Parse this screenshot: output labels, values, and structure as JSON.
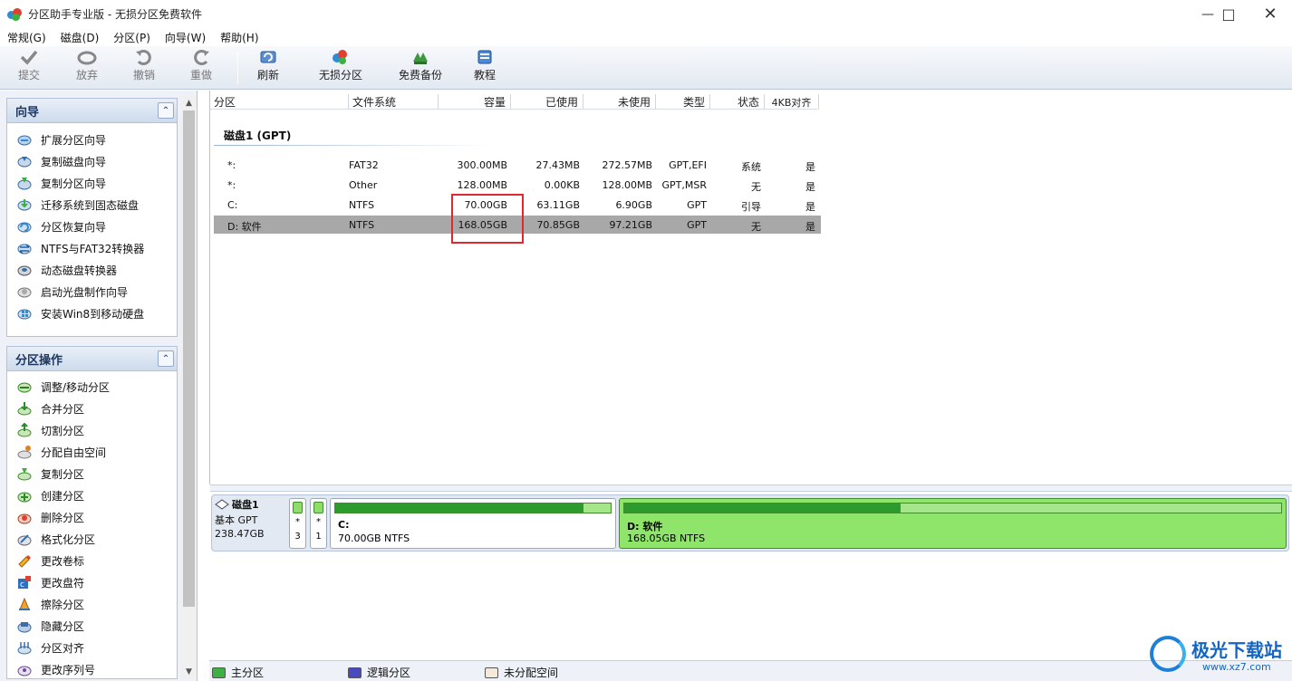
{
  "window": {
    "title": "分区助手专业版 - 无损分区免费软件"
  },
  "menu": [
    "常规(G)",
    "磁盘(D)",
    "分区(P)",
    "向导(W)",
    "帮助(H)"
  ],
  "toolbar": {
    "submit": "提交",
    "discard": "放弃",
    "undo": "撤销",
    "redo": "重做",
    "refresh": "刷新",
    "lossless": "无损分区",
    "backup": "免费备份",
    "tutorial": "教程"
  },
  "wizard": {
    "title": "向导",
    "items": [
      "扩展分区向导",
      "复制磁盘向导",
      "复制分区向导",
      "迁移系统到固态磁盘",
      "分区恢复向导",
      "NTFS与FAT32转换器",
      "动态磁盘转换器",
      "启动光盘制作向导",
      "安装Win8到移动硬盘"
    ]
  },
  "ops": {
    "title": "分区操作",
    "items": [
      "调整/移动分区",
      "合并分区",
      "切割分区",
      "分配自由空间",
      "复制分区",
      "创建分区",
      "删除分区",
      "格式化分区",
      "更改卷标",
      "更改盘符",
      "擦除分区",
      "隐藏分区",
      "分区对齐",
      "更改序列号"
    ]
  },
  "table": {
    "headers": [
      "分区",
      "文件系统",
      "容量",
      "已使用",
      "未使用",
      "类型",
      "状态",
      "4KB对齐"
    ],
    "disk_label": "磁盘1 (GPT)",
    "rows": [
      {
        "name": "*:",
        "fs": "FAT32",
        "cap": "300.00MB",
        "used": "27.43MB",
        "free": "272.57MB",
        "type": "GPT,EFI",
        "status": "系统",
        "align": "是"
      },
      {
        "name": "*:",
        "fs": "Other",
        "cap": "128.00MB",
        "used": "0.00KB",
        "free": "128.00MB",
        "type": "GPT,MSR",
        "status": "无",
        "align": "是"
      },
      {
        "name": "C:",
        "fs": "NTFS",
        "cap": "70.00GB",
        "used": "63.11GB",
        "free": "6.90GB",
        "type": "GPT",
        "status": "引导",
        "align": "是"
      },
      {
        "name": "D: 软件",
        "fs": "NTFS",
        "cap": "168.05GB",
        "used": "70.85GB",
        "free": "97.21GB",
        "type": "GPT",
        "status": "无",
        "align": "是"
      }
    ]
  },
  "diskmap": {
    "disk_name": "磁盘1",
    "disk_type": "基本 GPT",
    "disk_size": "238.47GB",
    "small1": {
      "star": "*",
      "num": "3"
    },
    "small2": {
      "star": "*",
      "num": "1"
    },
    "c": {
      "name": "C:",
      "info": "70.00GB NTFS",
      "used_fraction": 0.9
    },
    "d": {
      "name": "D: 软件",
      "info": "168.05GB NTFS",
      "used_fraction": 0.42
    }
  },
  "legend": {
    "primary": "主分区",
    "logical": "逻辑分区",
    "unalloc": "未分配空间"
  },
  "colors": {
    "primary": "#3cb043",
    "logical": "#4a4ac0",
    "unalloc": "#f3eadc",
    "highlight": "#e0292e",
    "selected_row": "#a8a8a8"
  },
  "watermark": {
    "text": "极光下载站",
    "url": "www.xz7.com"
  }
}
